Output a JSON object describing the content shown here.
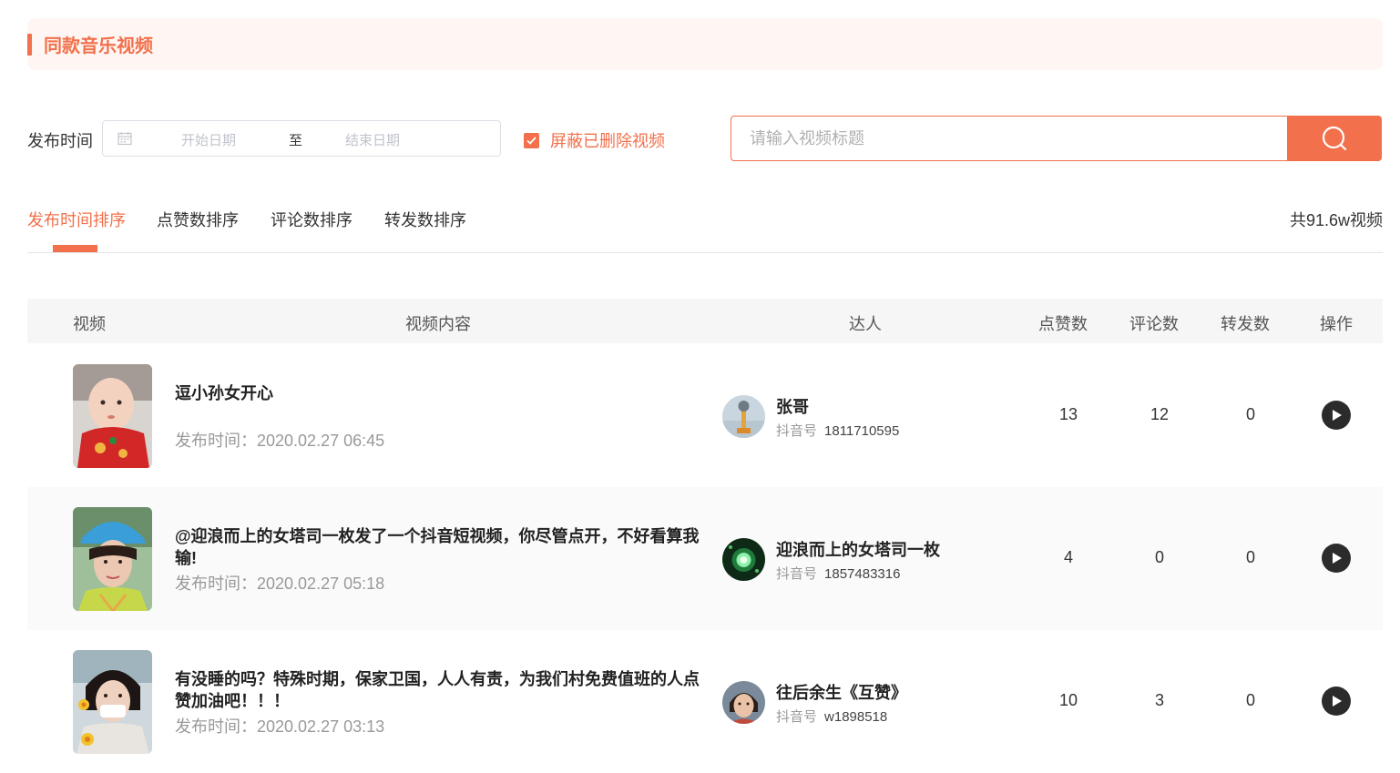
{
  "header": {
    "title": "同款音乐视频"
  },
  "filter": {
    "pub_label": "发布时间",
    "start_placeholder": "开始日期",
    "separator": "至",
    "end_placeholder": "结束日期",
    "hide_deleted_label": "屏蔽已删除视频",
    "hide_deleted_checked": true,
    "search_placeholder": "请输入视频标题"
  },
  "tabs": [
    {
      "label": "发布时间排序",
      "active": true
    },
    {
      "label": "点赞数排序",
      "active": false
    },
    {
      "label": "评论数排序",
      "active": false
    },
    {
      "label": "转发数排序",
      "active": false
    }
  ],
  "total": "共91.6w视频",
  "table": {
    "headers": {
      "video": "视频",
      "content": "视频内容",
      "author": "达人",
      "likes": "点赞数",
      "comments": "评论数",
      "shares": "转发数",
      "action": "操作"
    },
    "rows": [
      {
        "title": "逗小孙女开心",
        "pub_time": "发布时间：2020.02.27 06:45",
        "author": "张哥",
        "douyin_key": "抖音号",
        "douyin_id": "1811710595",
        "likes": "13",
        "comments": "12",
        "shares": "0"
      },
      {
        "title": "@迎浪而上的女塔司一枚发了一个抖音短视频，你尽管点开，不好看算我输!",
        "pub_time": "发布时间：2020.02.27 05:18",
        "author": "迎浪而上的女塔司一枚",
        "douyin_key": "抖音号",
        "douyin_id": "1857483316",
        "likes": "4",
        "comments": "0",
        "shares": "0"
      },
      {
        "title": "有没睡的吗？特殊时期，保家卫国，人人有责，为我们村免费值班的人点赞加油吧！！！",
        "pub_time": "发布时间：2020.02.27 03:13",
        "author": "往后余生《互赞》",
        "douyin_key": "抖音号",
        "douyin_id": "w1898518",
        "likes": "10",
        "comments": "3",
        "shares": "0"
      }
    ]
  },
  "colors": {
    "accent": "#f2704b",
    "header_bg": "#fff6f3",
    "table_head_bg": "#f6f6f6"
  },
  "icons": {
    "calendar": "calendar-icon",
    "check": "check-icon",
    "search": "search-icon",
    "play": "play-icon"
  }
}
